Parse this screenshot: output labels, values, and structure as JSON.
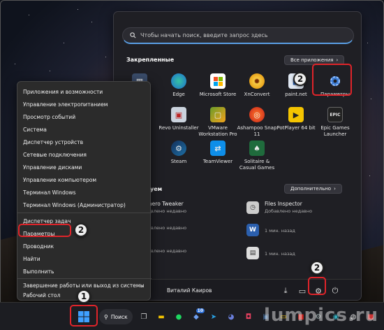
{
  "search": {
    "placeholder": "Чтобы начать поиск, введите запрос здесь"
  },
  "pinned": {
    "title": "Закрепленные",
    "all_apps": "Все приложения",
    "apps": [
      {
        "label": "",
        "icon": "calculator-icon"
      },
      {
        "label": "Edge",
        "icon": "edge-icon"
      },
      {
        "label": "Microsoft Store",
        "icon": "store-icon"
      },
      {
        "label": "XnConvert",
        "icon": "xnconvert-icon"
      },
      {
        "label": "paint.net",
        "icon": "paintnet-icon"
      },
      {
        "label": "Параметры",
        "icon": "settings-icon"
      },
      {
        "label": "",
        "icon": "app-icon"
      },
      {
        "label": "Revo Uninstaller",
        "icon": "revo-icon"
      },
      {
        "label": "VMware Workstation Pro",
        "icon": "vmware-icon"
      },
      {
        "label": "Ashampoo Snap 11",
        "icon": "ashampoo-icon"
      },
      {
        "label": "PotPlayer 64 bit",
        "icon": "potplayer-icon"
      },
      {
        "label": "Epic Games Launcher",
        "icon": "epic-icon"
      },
      {
        "label": "",
        "icon": "app-icon"
      },
      {
        "label": "Steam",
        "icon": "steam-icon"
      },
      {
        "label": "TeamViewer",
        "icon": "teamviewer-icon"
      },
      {
        "label": "Solitaire & Casual Games",
        "icon": "solitaire-icon"
      }
    ]
  },
  "recommended": {
    "title": "ндуем",
    "more": "Дополнительно",
    "items": [
      {
        "name": "Winaero Tweaker",
        "time": "Добавлено недавно"
      },
      {
        "name": "Files Inspector",
        "time": "Добавлено недавно"
      },
      {
        "name": "",
        "time": "Добавлено недавно"
      },
      {
        "name": "",
        "time": "1 мин. назад"
      },
      {
        "name": "",
        "time": "Добавлено недавно"
      },
      {
        "name": "",
        "time": "1 мин. назад"
      }
    ]
  },
  "footer": {
    "user": "Виталий Каиров"
  },
  "context_menu": {
    "items": [
      "Приложения и возможности",
      "Управление электропитанием",
      "Просмотр событий",
      "Система",
      "Диспетчер устройств",
      "Сетевые подключения",
      "Управление дисками",
      "Управление компьютером",
      "Терминал Windows",
      "Терминал Windows (Администратор)",
      "Диспетчер задач",
      "Параметры",
      "Проводник",
      "Найти",
      "Выполнить",
      "Завершение работы или выход из системы",
      "Рабочий стол"
    ]
  },
  "taskbar": {
    "search_label": "Поиск",
    "badge_count": "10"
  },
  "annotations": {
    "step1": "1",
    "step2": "2"
  },
  "watermark": "lumpics.ru",
  "colors": {
    "highlight": "#e0242a",
    "accent": "#5aa0e6"
  }
}
